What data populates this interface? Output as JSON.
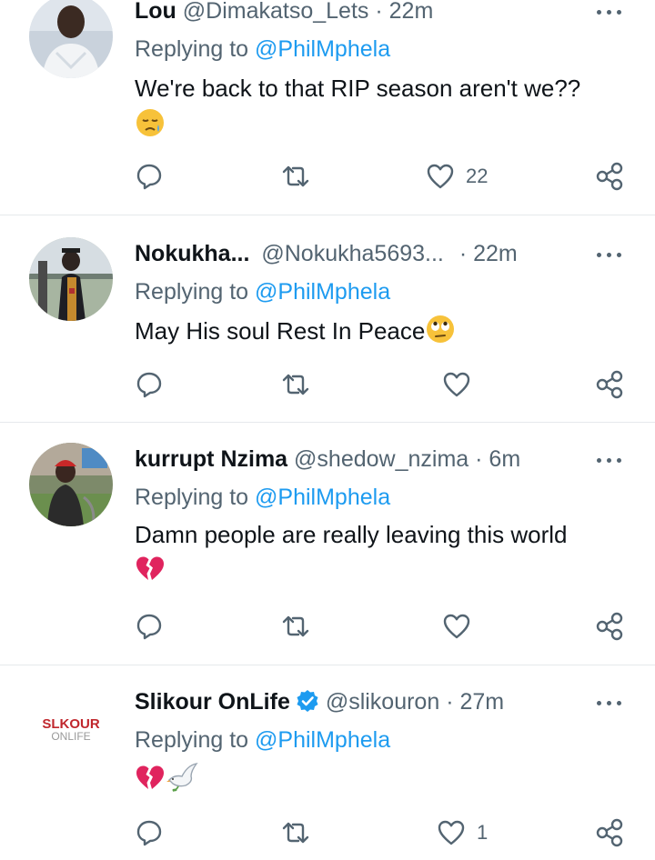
{
  "tweets": [
    {
      "name": "Lou",
      "handle": "@Dimakatso_Lets",
      "time": "22m",
      "separator": "·",
      "reply_prefix": "Replying to",
      "reply_to": "@PhilMphela",
      "text": "We're back to that RIP season aren't we??",
      "emojis": [
        "sad-tear-face-emoji"
      ],
      "likes": "22",
      "retweets": "",
      "replies": ""
    },
    {
      "name": "Nokukha...",
      "handle": "@Nokukha5693...",
      "time": "22m",
      "separator": "·",
      "reply_prefix": "Replying to",
      "reply_to": "@PhilMphela",
      "text": "May His soul Rest In Peace",
      "emojis": [
        "rolling-eyes-face-emoji"
      ],
      "likes": "",
      "retweets": "",
      "replies": ""
    },
    {
      "name": "kurrupt Nzima",
      "handle": "@shedow_nzima",
      "time": "6m",
      "separator": "·",
      "reply_prefix": "Replying to",
      "reply_to": "@PhilMphela",
      "text": "Damn people are really leaving this world",
      "emojis": [
        "broken-heart-emoji"
      ],
      "likes": "",
      "retweets": "",
      "replies": ""
    },
    {
      "name": "Slikour OnLife",
      "handle": "@slikouron",
      "time": "27m",
      "separator": "·",
      "reply_prefix": "Replying to",
      "reply_to": "@PhilMphela",
      "text": "",
      "emojis": [
        "broken-heart-emoji",
        "dove-emoji"
      ],
      "verified": true,
      "avatar_logo_top": "SLKOUR",
      "avatar_logo_bottom": "ONLIFE",
      "likes": "1",
      "retweets": "",
      "replies": ""
    }
  ],
  "colors": {
    "link": "#1d9bf0",
    "secondary_text": "#536471",
    "primary_text": "#0f1419",
    "divider": "#e6e9ec",
    "verified_badge": "#1d9bf0",
    "broken_heart": "#e0245e"
  }
}
